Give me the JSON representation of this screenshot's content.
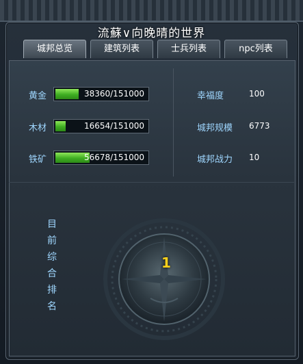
{
  "title": "流蘇∨向晚晴的世界",
  "tabs": [
    {
      "label": "城邦总览",
      "active": true
    },
    {
      "label": "建筑列表",
      "active": false
    },
    {
      "label": "士兵列表",
      "active": false
    },
    {
      "label": "npc列表",
      "active": false
    }
  ],
  "resources": [
    {
      "name": "黄金",
      "value": 38360,
      "max": 151000,
      "text": "38360/151000"
    },
    {
      "name": "木材",
      "value": 16654,
      "max": 151000,
      "text": "16654/151000"
    },
    {
      "name": "铁矿",
      "value": 56678,
      "max": 151000,
      "text": "56678/151000"
    }
  ],
  "stats": [
    {
      "label": "幸福度",
      "value": "100"
    },
    {
      "label": "城邦规模",
      "value": "6773"
    },
    {
      "label": "城邦战力",
      "value": "10"
    }
  ],
  "ranking": {
    "label_chars": [
      "目",
      "前",
      "综",
      "合",
      "排",
      "名"
    ],
    "value": "1"
  },
  "colors": {
    "label_blue": "#9fd7ff",
    "bar_green": "#3fae22",
    "rank_gold": "#ffd21a"
  },
  "icons": {
    "emblem": "compass-emblem-icon"
  }
}
